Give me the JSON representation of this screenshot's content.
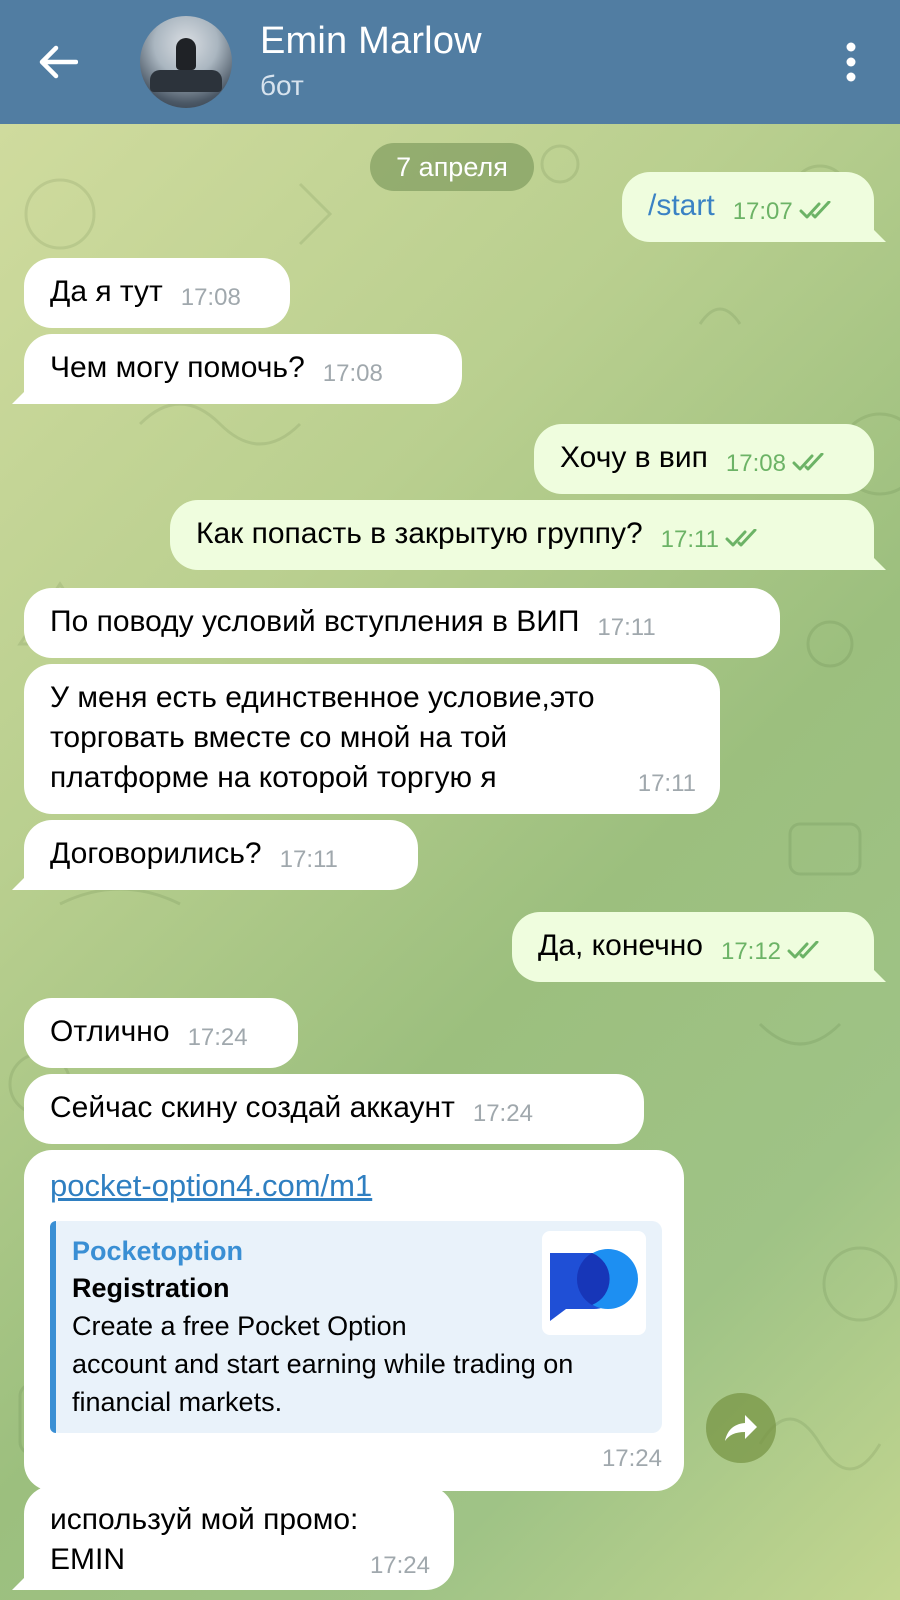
{
  "header": {
    "title": "Emin Marlow",
    "subtitle": "бот"
  },
  "date_chip": "7 апреля",
  "messages": [
    {
      "dir": "out",
      "text": "/start",
      "time": "17:07"
    },
    {
      "dir": "in",
      "text": "Да я тут",
      "time": "17:08"
    },
    {
      "dir": "in",
      "text": "Чем могу помочь?",
      "time": "17:08"
    },
    {
      "dir": "out",
      "text": "Хочу в вип",
      "time": "17:08"
    },
    {
      "dir": "out",
      "text": "Как попасть в закрытую группу?",
      "time": "17:11"
    },
    {
      "dir": "in",
      "text": "По поводу условий вступления в ВИП",
      "time": "17:11"
    },
    {
      "dir": "in",
      "lines": [
        "У меня есть единственное условие,это",
        "торговать вместе со мной на той",
        "платформе на которой торгую я"
      ],
      "time": "17:11"
    },
    {
      "dir": "in",
      "text": "Договорились?",
      "time": "17:11"
    },
    {
      "dir": "out",
      "text": "Да, конечно",
      "time": "17:12"
    },
    {
      "dir": "in",
      "text": "Отлично",
      "time": "17:24"
    },
    {
      "dir": "in",
      "text": "Сейчас скину создай аккаунт",
      "time": "17:24"
    },
    {
      "dir": "in",
      "link": "pocket-option4.com/m1",
      "time": "17:24",
      "preview": {
        "site": "Pocketoption",
        "title": "Registration",
        "description_lines": [
          "Create a free Pocket Option",
          "account and start earning while trading on",
          "financial markets."
        ]
      }
    },
    {
      "dir": "in",
      "lines": [
        "используй мой промо:",
        "EMIN"
      ],
      "time": "17:24"
    }
  ],
  "colors": {
    "header_bg": "#517da2",
    "incoming_bubble": "#ffffff",
    "outgoing_bubble": "#effdde",
    "outgoing_time": "#6cb366",
    "link": "#2f7fc1"
  },
  "icons": {
    "back": "arrow-left-icon",
    "menu": "more-vertical-icon",
    "read": "double-check-icon",
    "share": "share-forward-icon"
  }
}
